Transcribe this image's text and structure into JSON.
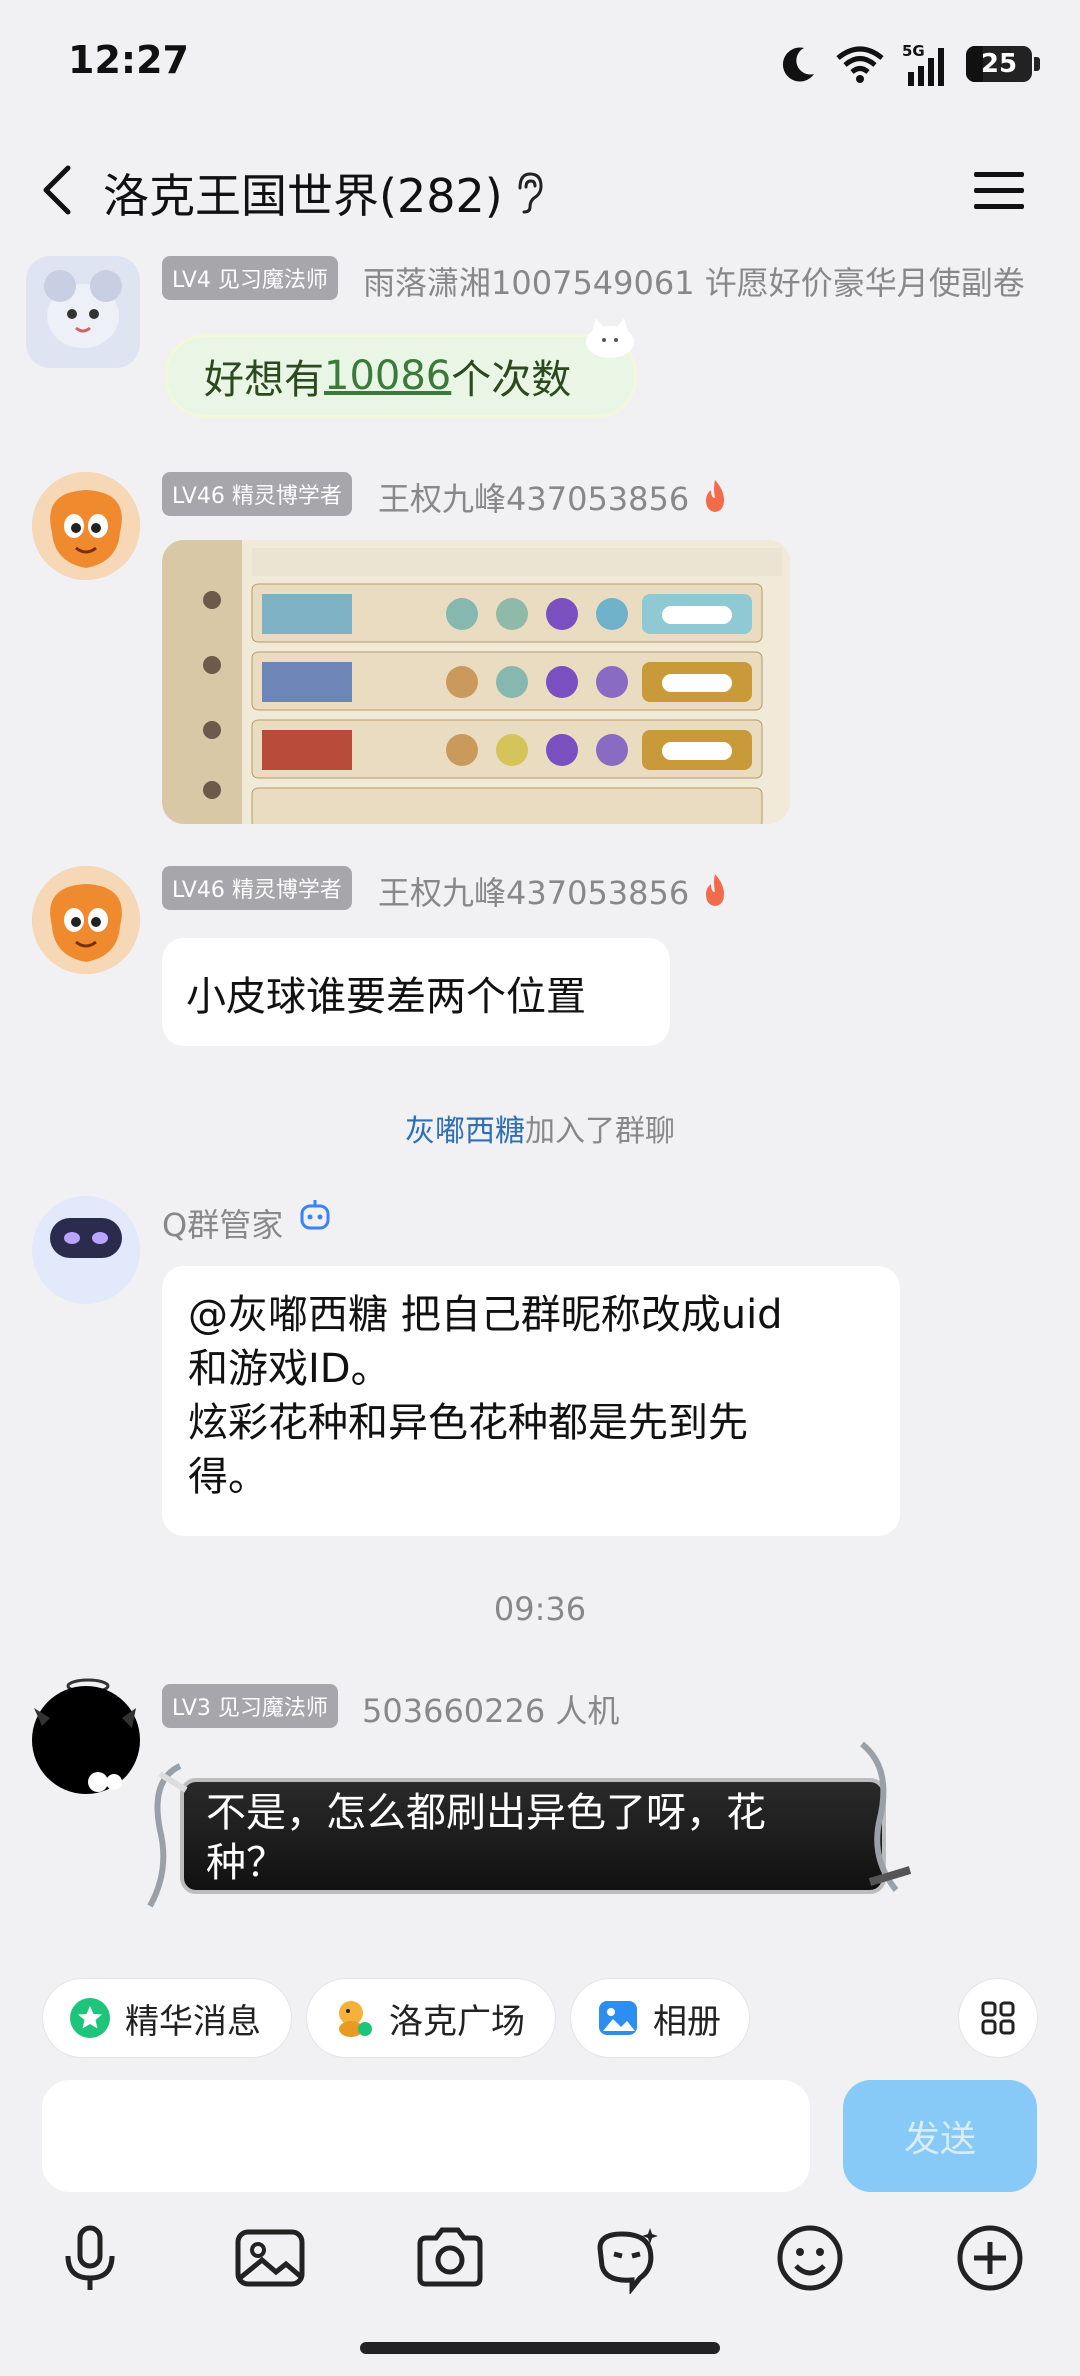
{
  "status_bar": {
    "time": "12:27",
    "battery": "25"
  },
  "header": {
    "title": "洛克王国世界(282)"
  },
  "messages": {
    "m1": {
      "level": "LV4 见习魔法师",
      "sender": "雨落潇湘1007549061 许愿好价豪华月使副卷",
      "text_pre": "好想有",
      "text_link": "10086",
      "text_post": "个次数"
    },
    "m2": {
      "level": "LV46 精灵博学者",
      "sender": "王权九峰437053856"
    },
    "m3": {
      "level": "LV46 精灵博学者",
      "sender": "王权九峰437053856",
      "text": "小皮球谁要差两个位置"
    },
    "sys_join": {
      "name": "灰嘟西糖",
      "suffix": "加入了群聊"
    },
    "m4": {
      "sender": "Q群管家",
      "line1": "@灰嘟西糖 把自己群昵称改成uid",
      "line2": "和游戏ID。",
      "line3": "炫彩花种和异色花种都是先到先",
      "line4": "得。"
    },
    "time_sep": "09:36",
    "m5": {
      "level": "LV3 见习魔法师",
      "sender": "503660226 人机",
      "line1": "不是，怎么都刷出异色了呀，花",
      "line2": "种？"
    }
  },
  "quick_bar": {
    "essence": "精华消息",
    "plaza": "洛克广场",
    "album": "相册"
  },
  "input": {
    "send": "发送"
  },
  "colors": {
    "send_button": "#87c9f7",
    "link": "#2f6fb4",
    "fire": "#f26b4b"
  }
}
